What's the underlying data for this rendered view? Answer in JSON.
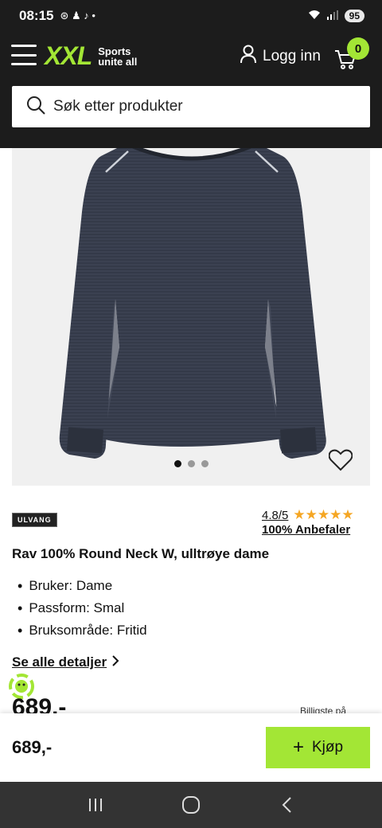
{
  "status_bar": {
    "time": "08:15",
    "battery": "95"
  },
  "header": {
    "logo_text": "XXL",
    "tagline_line1": "Sports",
    "tagline_line2": "unite all",
    "login_label": "Logg inn",
    "cart_count": "0",
    "search_placeholder": "Søk etter produkter"
  },
  "product": {
    "image_dots": 3,
    "active_dot": 0,
    "brand": "ULVANG",
    "rating": "4.8/5",
    "stars": "★★★★★",
    "recommend": "100% Anbefaler",
    "title": "Rav 100% Round Neck W, ulltrøye dame",
    "features": [
      "Bruker: Dame",
      "Passform: Smal",
      "Bruksområde: Fritid"
    ],
    "details_link": "Se alle detaljer",
    "price_partial": "689,-",
    "cheapest_label": "Billigste på"
  },
  "buy_bar": {
    "price": "689,-",
    "button_label": "Kjøp"
  },
  "colors": {
    "accent": "#a3e635",
    "header_bg": "#1c1c1c",
    "star": "#f5a623"
  }
}
